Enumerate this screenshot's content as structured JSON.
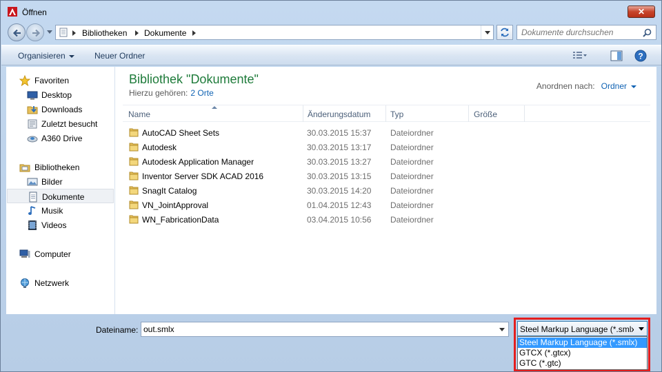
{
  "window": {
    "title": "Öffnen",
    "close_label": "✕"
  },
  "nav": {
    "breadcrumb": [
      "Bibliotheken",
      "Dokumente"
    ],
    "search_placeholder": "Dokumente durchsuchen"
  },
  "toolbar": {
    "organize": "Organisieren",
    "new_folder": "Neuer Ordner"
  },
  "sidebar": {
    "favorites": {
      "label": "Favoriten",
      "items": [
        "Desktop",
        "Downloads",
        "Zuletzt besucht",
        "A360 Drive"
      ]
    },
    "libraries": {
      "label": "Bibliotheken",
      "items": [
        "Bilder",
        "Dokumente",
        "Musik",
        "Videos"
      ],
      "selected": "Dokumente"
    },
    "computer": "Computer",
    "network": "Netzwerk"
  },
  "main": {
    "title": "Bibliothek \"Dokumente\"",
    "subtitle_prefix": "Hierzu gehören:",
    "subtitle_link": "2 Orte",
    "arrange_label": "Anordnen nach:",
    "arrange_value": "Ordner",
    "columns": [
      "Name",
      "Änderungsdatum",
      "Typ",
      "Größe"
    ],
    "files": [
      {
        "name": "AutoCAD Sheet Sets",
        "date": "30.03.2015 15:37",
        "type": "Dateiordner"
      },
      {
        "name": "Autodesk",
        "date": "30.03.2015 13:17",
        "type": "Dateiordner"
      },
      {
        "name": "Autodesk Application Manager",
        "date": "30.03.2015 13:27",
        "type": "Dateiordner"
      },
      {
        "name": "Inventor Server SDK ACAD 2016",
        "date": "30.03.2015 13:15",
        "type": "Dateiordner"
      },
      {
        "name": "SnagIt Catalog",
        "date": "30.03.2015 14:20",
        "type": "Dateiordner"
      },
      {
        "name": "VN_JointApproval",
        "date": "01.04.2015 12:43",
        "type": "Dateiordner"
      },
      {
        "name": "WN_FabricationData",
        "date": "03.04.2015 10:56",
        "type": "Dateiordner"
      }
    ]
  },
  "footer": {
    "filename_label": "Dateiname:",
    "filename_value": "out.smlx",
    "filetype_selected": "Steel Markup Language (*.smlx)",
    "filetype_options": [
      "Steel Markup Language (*.smlx)",
      "GTCX (*.gtcx)",
      "GTC (*.gtc)"
    ]
  },
  "colors": {
    "accent_red": "#e41e1e",
    "title_green": "#1e7b3a",
    "link_blue": "#0f62b3",
    "selection_blue": "#3399ff"
  }
}
